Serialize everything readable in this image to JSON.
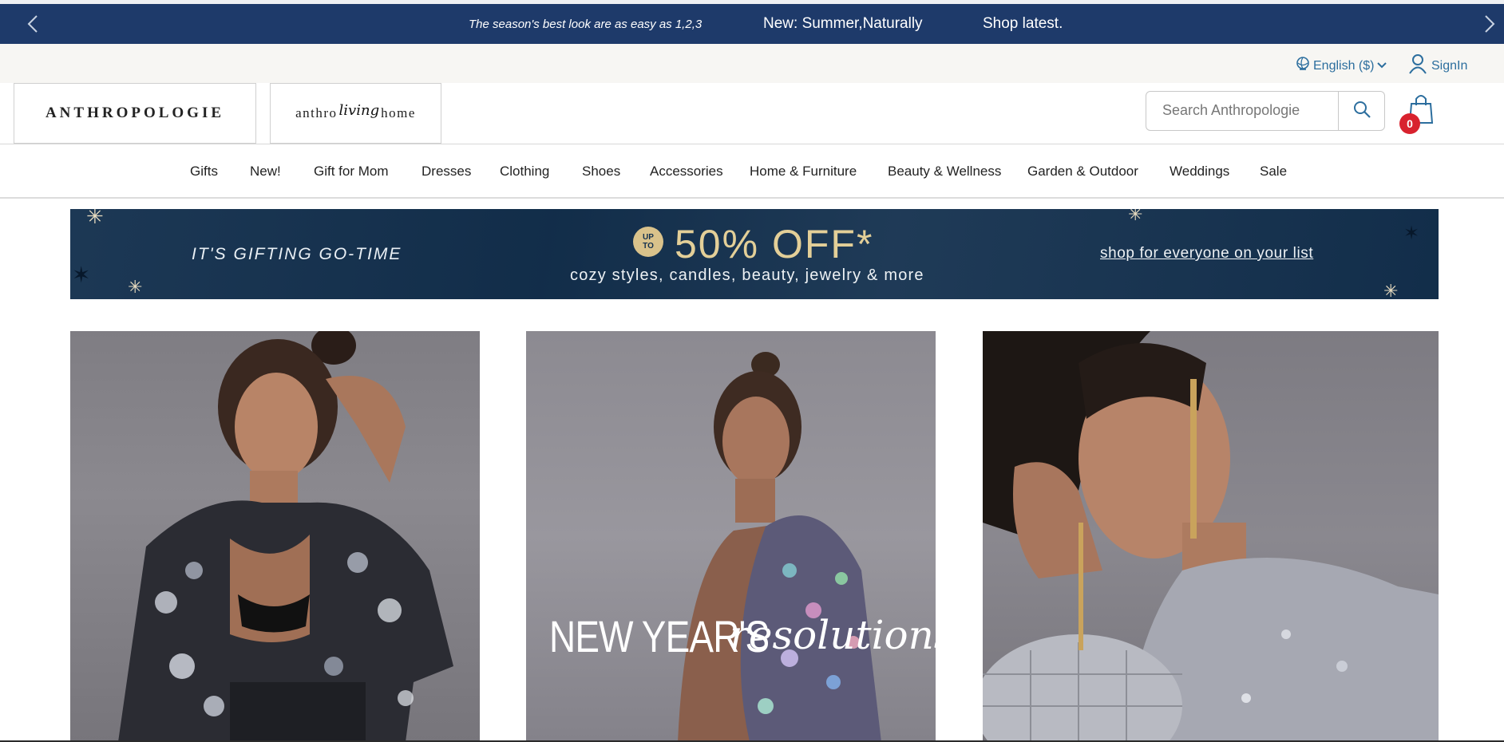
{
  "promo_bar": {
    "messages": [
      "The season's best look are as easy as 1,2,3",
      "New: Summer,Naturally",
      "Shop latest."
    ],
    "prev_icon": "chevron-left-icon",
    "next_icon": "chevron-right-icon",
    "background": "#1e3a6a"
  },
  "utility_bar": {
    "language": "English ($)",
    "signin": "SignIn",
    "link_color": "#2c6e9e"
  },
  "header": {
    "logo_primary": "ANTHROPOLOGIE",
    "logo_secondary": {
      "part1": "anthro",
      "part2": "living",
      "part3": "home"
    },
    "search_placeholder": "Search Anthropologie",
    "cart_count": "0",
    "badge_color": "#d8222e"
  },
  "nav": {
    "items": [
      "Gifts",
      "New!",
      "Gift for Mom",
      "Dresses",
      "Clothing",
      "Shoes",
      "Accessories",
      "Home & Furniture",
      "Beauty & Wellness",
      "Garden & Outdoor",
      "Weddings",
      "Sale"
    ]
  },
  "banner": {
    "left": "IT'S GIFTING GO-TIME",
    "up_to_top": "UP",
    "up_to_bottom": "TO",
    "headline": "50% OFF*",
    "subline": "cozy styles, candles, beauty, jewelry & more",
    "cta": "shop for everyone on your list",
    "background": "#13304e",
    "accent": "#e3cf98"
  },
  "tiles": [
    {
      "name": "sequin-jacket"
    },
    {
      "name": "new-years",
      "overlay_main": "NEW YEAR'S",
      "overlay_script": "resolutions"
    },
    {
      "name": "sequin-top"
    }
  ]
}
